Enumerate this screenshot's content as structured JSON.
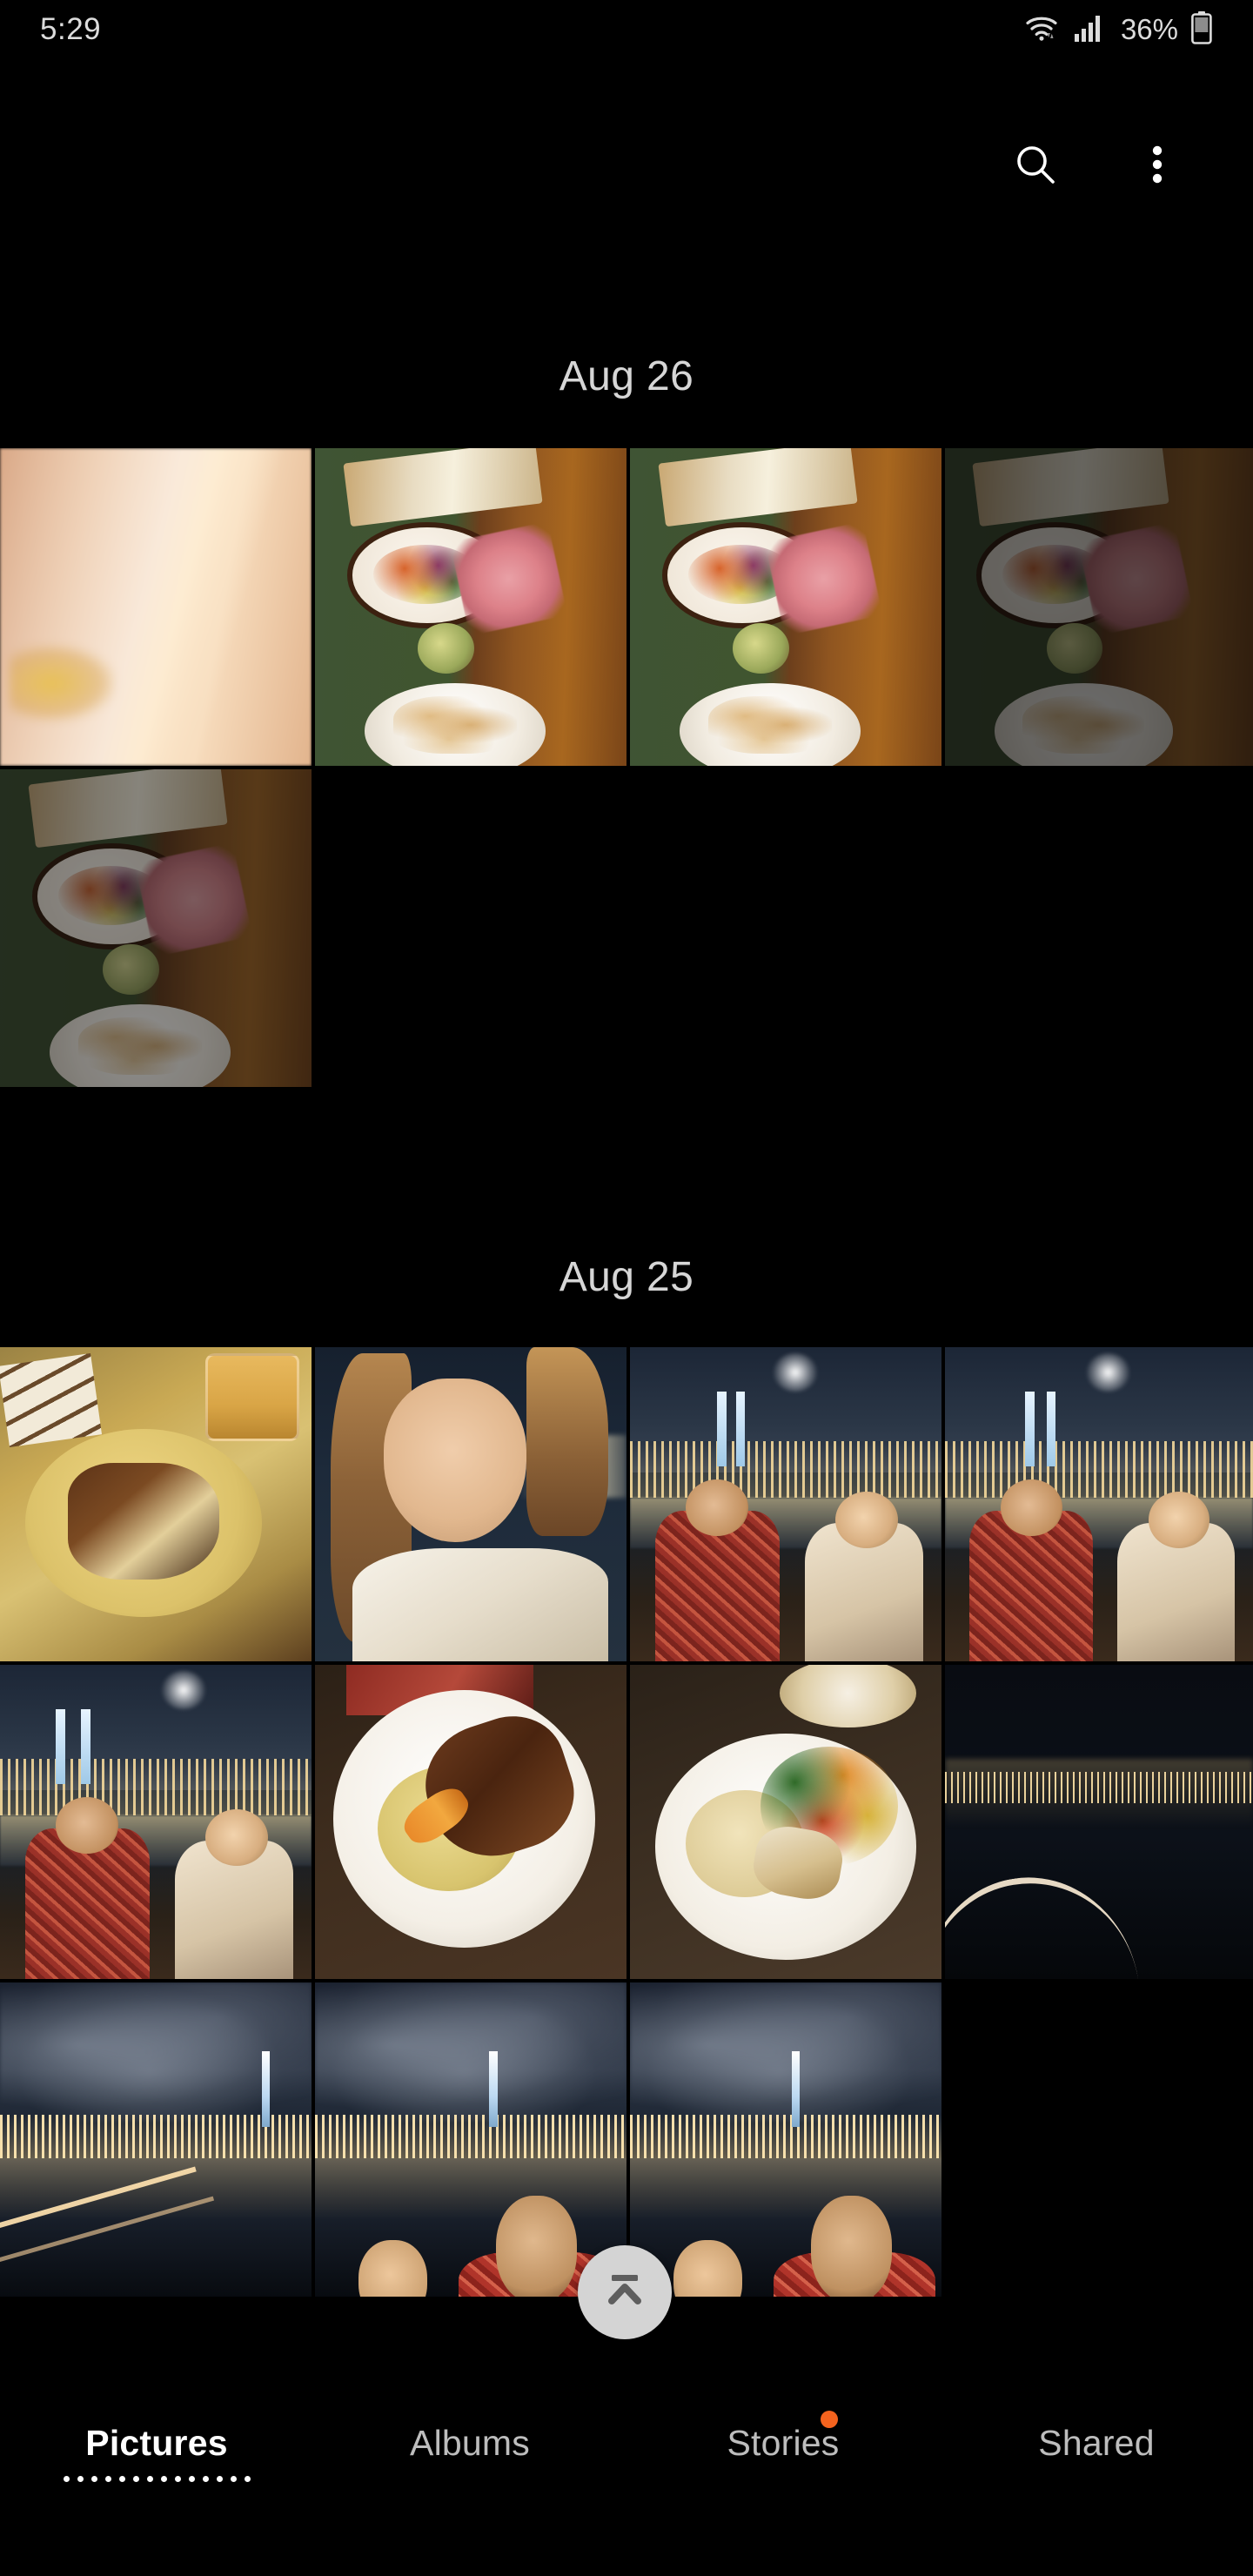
{
  "app": {
    "name": "Gallery",
    "background": "#000000"
  },
  "status_bar": {
    "time": "5:29",
    "battery_percent": "36%",
    "icons": [
      "wifi-icon",
      "cellular-signal-icon",
      "battery-icon"
    ]
  },
  "action_bar": {
    "search_icon": "search-icon",
    "more_icon": "more-vertical-icon"
  },
  "sections": [
    {
      "date": "Aug 26",
      "photos": [
        {
          "caption": "Blurry warm window light",
          "style": "p-blurwarm"
        },
        {
          "caption": "Charcuterie board with plate and bread",
          "style": "p-board"
        },
        {
          "caption": "Charcuterie board with plate and bread (duplicate)",
          "style": "p-board"
        },
        {
          "caption": "Dim charcuterie table with wine glass",
          "style": "p-board p-boarddim"
        },
        {
          "caption": "Charcuterie board on wooden table",
          "style": "p-board p-boarddim2"
        }
      ]
    },
    {
      "date": "Aug 25",
      "photos": [
        {
          "caption": "Dessert plate with drink",
          "style": "p-dessert"
        },
        {
          "caption": "Selfie of a woman at night",
          "style": "p-selfie"
        },
        {
          "caption": "Couple at table with city skyline",
          "style": "p-couple"
        },
        {
          "caption": "Couple at table with city skyline (duplicate)",
          "style": "p-couple"
        },
        {
          "caption": "Couple with skyline behind",
          "style": "p-couple"
        },
        {
          "caption": "Steak with mashed potatoes",
          "style": "p-steak"
        },
        {
          "caption": "Fish with rice and vegetables",
          "style": "p-fish"
        },
        {
          "caption": "Dark night skyline over water",
          "style": "p-night"
        },
        {
          "caption": "Night skyline with railing",
          "style": "p-skyline"
        },
        {
          "caption": "Couple selfie with skyline",
          "style": "p-skyline"
        },
        {
          "caption": "Couple selfie with skyline (duplicate)",
          "style": "p-skyline"
        }
      ]
    }
  ],
  "scroll_to_top": {
    "icon": "scroll-to-top-icon",
    "fill": "#d4d4d4"
  },
  "bottom_nav": {
    "items": [
      {
        "label": "Pictures",
        "active": true,
        "badge": false
      },
      {
        "label": "Albums",
        "active": false,
        "badge": false
      },
      {
        "label": "Stories",
        "active": false,
        "badge": true
      },
      {
        "label": "Shared",
        "active": false,
        "badge": false
      }
    ],
    "badge_color": "#f4631e",
    "active_color": "#ffffff",
    "inactive_color": "#bdbdbd"
  }
}
